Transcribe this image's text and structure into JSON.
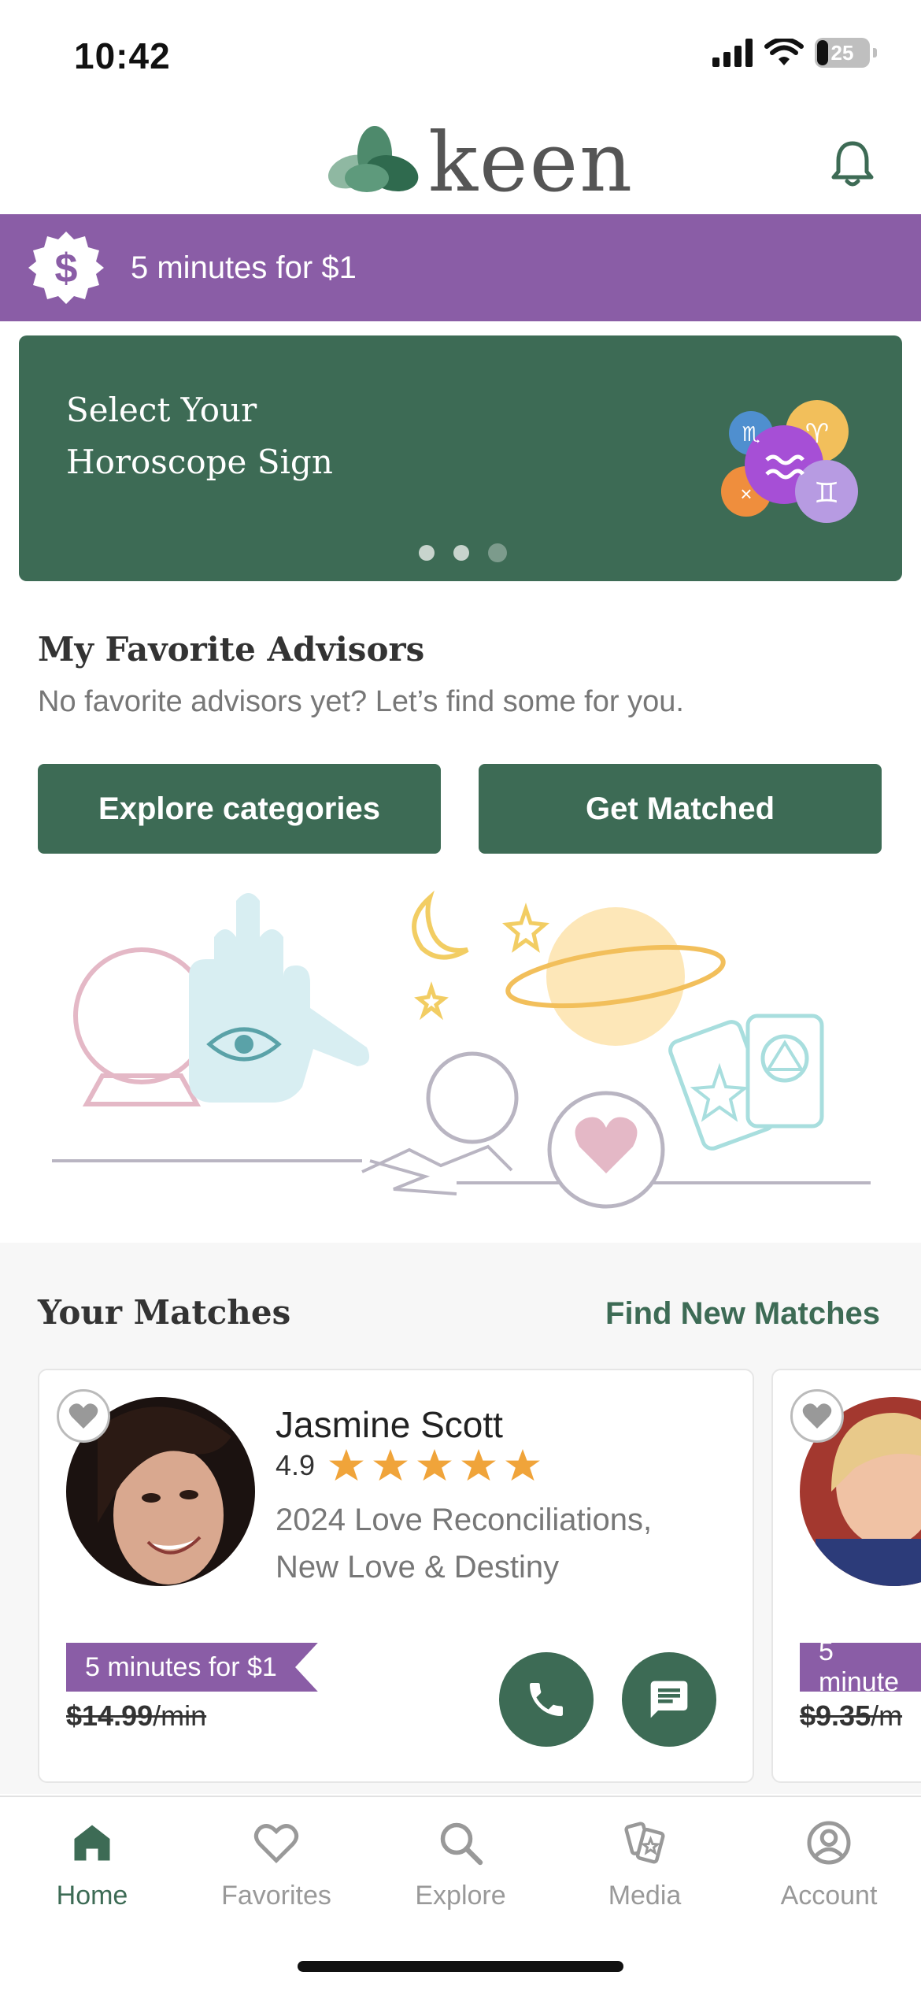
{
  "status": {
    "time": "10:42",
    "battery": "25"
  },
  "header": {
    "logo_text": "keen"
  },
  "promo": {
    "text": "5 minutes for $1"
  },
  "hero": {
    "title": "Select Your\nHoroscope Sign"
  },
  "favorites": {
    "title": "My Favorite Advisors",
    "subtitle": "No favorite advisors yet? Let’s find some for you.",
    "explore_label": "Explore categories",
    "match_label": "Get Matched"
  },
  "matches": {
    "title": "Your Matches",
    "link": "Find New Matches",
    "advisors": [
      {
        "name": "Jasmine Scott",
        "rating": "4.9",
        "specialty": "2024 Love Reconciliations, New Love & Destiny",
        "promo": "5 minutes for $1",
        "price": "$14.99",
        "per": "/min"
      },
      {
        "promo": "5 minute",
        "price": "$9.35",
        "per": "/m"
      }
    ]
  },
  "tabs": [
    {
      "label": "Home",
      "icon": "home-icon"
    },
    {
      "label": "Favorites",
      "icon": "heart-icon"
    },
    {
      "label": "Explore",
      "icon": "search-icon"
    },
    {
      "label": "Media",
      "icon": "cards-icon"
    },
    {
      "label": "Account",
      "icon": "account-icon"
    }
  ],
  "colors": {
    "brand_green": "#3d6b55",
    "promo_purple": "#8a5da6",
    "star_orange": "#f0a43a"
  }
}
